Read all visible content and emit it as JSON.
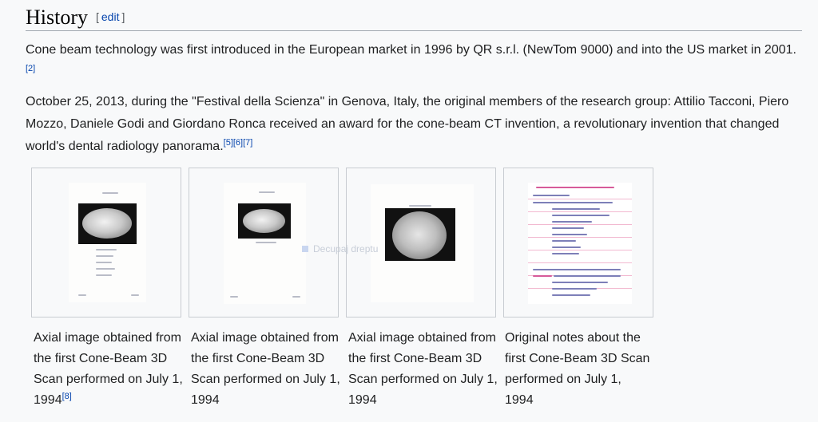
{
  "section": {
    "title": "History",
    "edit_open": "[",
    "edit_label": "edit",
    "edit_close": "]"
  },
  "paragraphs": [
    {
      "text": "Cone beam technology was first introduced in the European market in 1996 by QR s.r.l. (NewTom 9000) and into the US market in 2001.",
      "refs": "[2]"
    },
    {
      "text": "October 25, 2013, during the \"Festival della Scienza\" in Genova, Italy, the original members of the research group: Attilio Tacconi, Piero Mozzo, Daniele Godi and Giordano Ronca received an award for the cone-beam CT invention, a revolutionary invention that changed world's dental radiology panorama.",
      "refs": [
        "[5]",
        "[6]",
        "[7]"
      ]
    }
  ],
  "gallery": [
    {
      "caption": "Axial image obtained from the first Cone-Beam 3D Scan performed on July 1, 1994",
      "ref": "[8]"
    },
    {
      "caption": "Axial image obtained from the first Cone-Beam 3D Scan performed on July 1, 1994",
      "ref": ""
    },
    {
      "caption": "Axial image obtained from the first Cone-Beam 3D Scan performed on July 1, 1994",
      "ref": ""
    },
    {
      "caption": "Original notes about the first Cone-Beam 3D Scan performed on July 1, 1994",
      "ref": ""
    }
  ],
  "overlay": {
    "watermark": "Decupaj dreptu"
  },
  "colors": {
    "link": "#0645ad",
    "text": "#202122",
    "rule": "#a2a9b1",
    "thumb_border": "#c8ccd1"
  }
}
